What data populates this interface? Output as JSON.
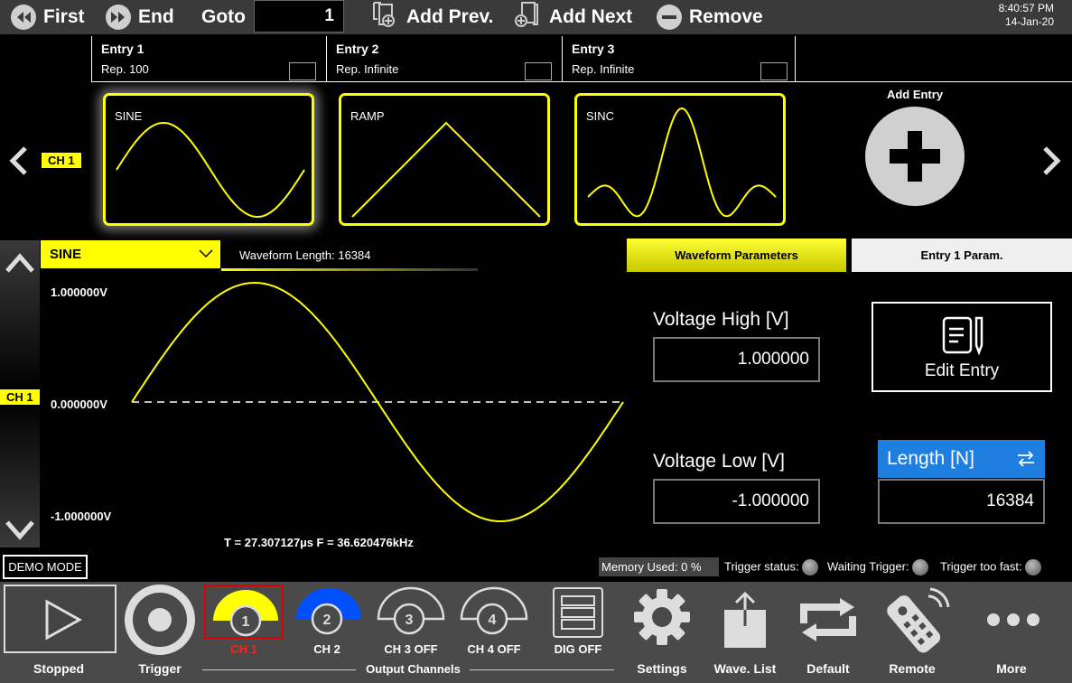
{
  "toolbar": {
    "first": "First",
    "end": "End",
    "goto": "Goto",
    "goto_value": "1",
    "add_prev": "Add Prev.",
    "add_next": "Add Next",
    "remove": "Remove",
    "time": "8:40:57 PM",
    "date": "14-Jan-20"
  },
  "entries": [
    {
      "title": "Entry  1",
      "rep": "Rep.  100",
      "wave": "SINE"
    },
    {
      "title": "Entry  2",
      "rep": "Rep.  Infinite",
      "wave": "RAMP"
    },
    {
      "title": "Entry  3",
      "rep": "Rep.  Infinite",
      "wave": "SINC"
    }
  ],
  "add_entry": "Add Entry",
  "channel_tag": "CH 1",
  "waveform": {
    "selected": "SINE",
    "length_label": "Waveform Length:  16384",
    "ymax": "1.000000V",
    "ymid": "0.000000V",
    "ymin": "-1.000000V",
    "period": "T =  27.307127µs   F =  36.620476kHz"
  },
  "tabs": {
    "waveform_params": "Waveform Parameters",
    "entry_params": "Entry  1  Param."
  },
  "params": {
    "vhigh_label": "Voltage High [V]",
    "vhigh_value": "1.000000",
    "vlow_label": "Voltage Low [V]",
    "vlow_value": "-1.000000",
    "length_label": "Length [N]",
    "length_value": "16384",
    "edit_entry": "Edit Entry"
  },
  "status": {
    "demo": "DEMO MODE",
    "memory": "Memory Used:   0 %",
    "trigger_status": "Trigger status:",
    "waiting_trigger": "Waiting Trigger:",
    "trigger_too_fast": "Trigger too fast:"
  },
  "bottom": {
    "stopped": "Stopped",
    "trigger": "Trigger",
    "ch1": "CH 1",
    "ch2": "CH 2",
    "ch3": "CH 3 OFF",
    "ch4": "CH 4 OFF",
    "dig": "DIG OFF",
    "output_channels": "Output Channels",
    "settings": "Settings",
    "wave_list": "Wave. List",
    "default": "Default",
    "remote": "Remote",
    "more": "More",
    "ch1_num": "1",
    "ch2_num": "2",
    "ch3_num": "3",
    "ch4_num": "4"
  },
  "colors": {
    "accent": "#ffff00",
    "ch2": "#0050ff",
    "length_header": "#1e7fe0",
    "ch1_active_label": "#ff2020"
  }
}
